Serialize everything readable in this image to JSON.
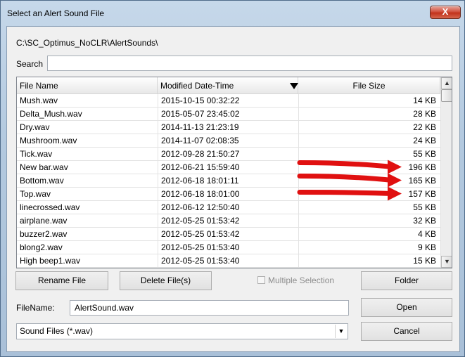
{
  "window": {
    "title": "Select an Alert Sound File",
    "close_label": "X"
  },
  "path": "C:\\SC_Optimus_NoCLR\\AlertSounds\\",
  "search": {
    "label": "Search",
    "value": ""
  },
  "table": {
    "columns": [
      "File Name",
      "Modified Date-Time",
      "File Size"
    ],
    "sort_column": "Modified Date-Time",
    "sort_direction": "descending",
    "rows": [
      {
        "name": "Mush.wav",
        "date": "2015-10-15  00:32:22",
        "size": "14 KB"
      },
      {
        "name": "Delta_Mush.wav",
        "date": "2015-05-07  23:45:02",
        "size": "28 KB"
      },
      {
        "name": "Dry.wav",
        "date": "2014-11-13  21:23:19",
        "size": "22 KB"
      },
      {
        "name": "Mushroom.wav",
        "date": "2014-11-07  02:08:35",
        "size": "24 KB"
      },
      {
        "name": "Tick.wav",
        "date": "2012-09-28  21:50:27",
        "size": "55 KB"
      },
      {
        "name": "New bar.wav",
        "date": "2012-06-21  15:59:40",
        "size": "196 KB"
      },
      {
        "name": "Bottom.wav",
        "date": "2012-06-18  18:01:11",
        "size": "165 KB"
      },
      {
        "name": "Top.wav",
        "date": "2012-06-18  18:01:00",
        "size": "157 KB"
      },
      {
        "name": "linecrossed.wav",
        "date": "2012-06-12  12:50:40",
        "size": "55 KB"
      },
      {
        "name": "airplane.wav",
        "date": "2012-05-25  01:53:42",
        "size": "32 KB"
      },
      {
        "name": "buzzer2.wav",
        "date": "2012-05-25  01:53:42",
        "size": "4 KB"
      },
      {
        "name": "blong2.wav",
        "date": "2012-05-25  01:53:40",
        "size": "9 KB"
      },
      {
        "name": "High beep1.wav",
        "date": "2012-05-25  01:53:40",
        "size": "15 KB"
      }
    ],
    "highlighted_rows": [
      "New bar.wav",
      "Bottom.wav",
      "Top.wav"
    ],
    "annotation_color": "#e01010"
  },
  "buttons": {
    "rename": "Rename File",
    "delete": "Delete File(s)",
    "folder": "Folder",
    "open": "Open",
    "cancel": "Cancel"
  },
  "multiple_selection": {
    "label": "Multiple Selection",
    "checked": false,
    "enabled": false
  },
  "filename": {
    "label": "FileName:",
    "value": "AlertSound.wav"
  },
  "filetype": {
    "selected": "Sound Files (*.wav)"
  },
  "icons": {
    "sort": "sort-desc-icon",
    "scroll_up": "scroll-up-icon",
    "scroll_down": "scroll-down-icon",
    "dropdown": "chevron-down-icon"
  }
}
